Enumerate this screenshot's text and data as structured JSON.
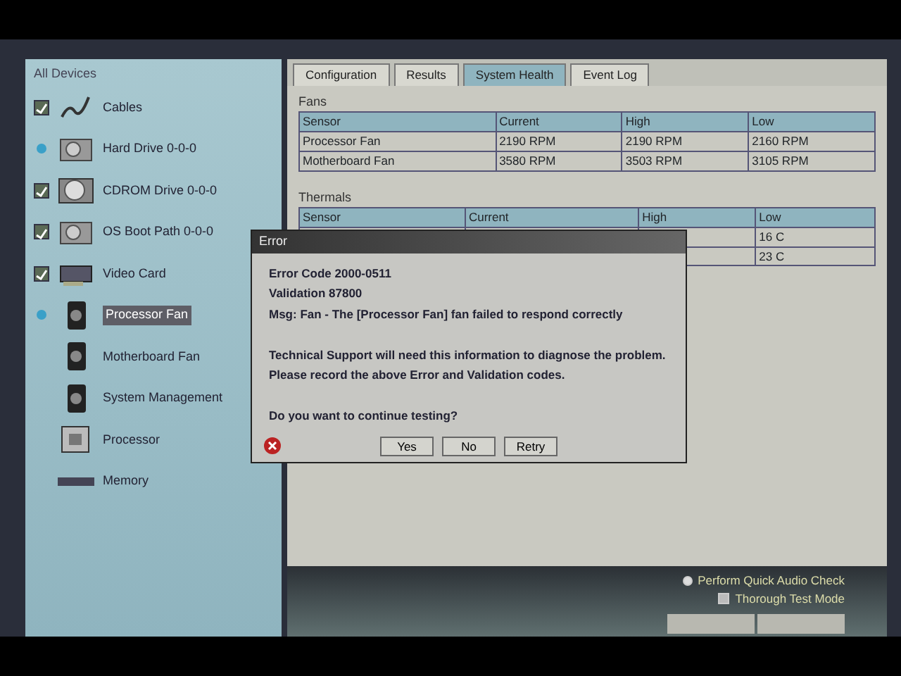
{
  "sidebar": {
    "title": "All Devices",
    "items": [
      {
        "label": "Cables",
        "kind": "checkbox",
        "checked": true,
        "selected": false
      },
      {
        "label": "Hard Drive 0-0-0",
        "kind": "dot",
        "selected": false
      },
      {
        "label": "CDROM Drive 0-0-0",
        "kind": "checkbox",
        "checked": true,
        "selected": false
      },
      {
        "label": "OS Boot Path 0-0-0",
        "kind": "checkbox",
        "checked": true,
        "selected": false
      },
      {
        "label": "Video Card",
        "kind": "checkbox",
        "checked": true,
        "selected": false
      },
      {
        "label": "Processor Fan",
        "kind": "dot",
        "selected": true
      },
      {
        "label": "Motherboard Fan",
        "kind": "plain",
        "selected": false
      },
      {
        "label": "System Management",
        "kind": "plain",
        "selected": false
      },
      {
        "label": "Processor",
        "kind": "plain",
        "selected": false
      },
      {
        "label": "Memory",
        "kind": "plain",
        "selected": false
      }
    ]
  },
  "tabs": [
    {
      "label": "Configuration",
      "selected": false
    },
    {
      "label": "Results",
      "selected": false
    },
    {
      "label": "System Health",
      "selected": true
    },
    {
      "label": "Event Log",
      "selected": false
    }
  ],
  "fans": {
    "title": "Fans",
    "columns": [
      "Sensor",
      "Current",
      "High",
      "Low"
    ],
    "rows": [
      [
        "Processor Fan",
        "2190 RPM",
        "2190 RPM",
        "2160 RPM"
      ],
      [
        "Motherboard Fan",
        "3580 RPM",
        "3503 RPM",
        "3105 RPM"
      ]
    ]
  },
  "thermals": {
    "title": "Thermals",
    "columns": [
      "Sensor",
      "Current",
      "High",
      "Low"
    ],
    "rows": [
      [
        "",
        "",
        "",
        "16 C"
      ],
      [
        "",
        "",
        "",
        "23 C"
      ]
    ]
  },
  "dialog": {
    "title": "Error",
    "paragraphs": [
      [
        "Error Code 2000-0511",
        "Validation 87800",
        "Msg: Fan - The [Processor Fan] fan failed to respond correctly"
      ],
      [
        "Technical Support will need this information to diagnose the problem.",
        "Please record the above Error and Validation codes."
      ],
      [
        "Do you want to continue testing?"
      ]
    ],
    "buttons": [
      "Yes",
      "No",
      "Retry"
    ]
  },
  "options": [
    {
      "kind": "radio",
      "label": "Perform Quick Audio Check",
      "checked": true
    },
    {
      "kind": "checkbox",
      "label": "Thorough Test Mode",
      "checked": false
    }
  ]
}
